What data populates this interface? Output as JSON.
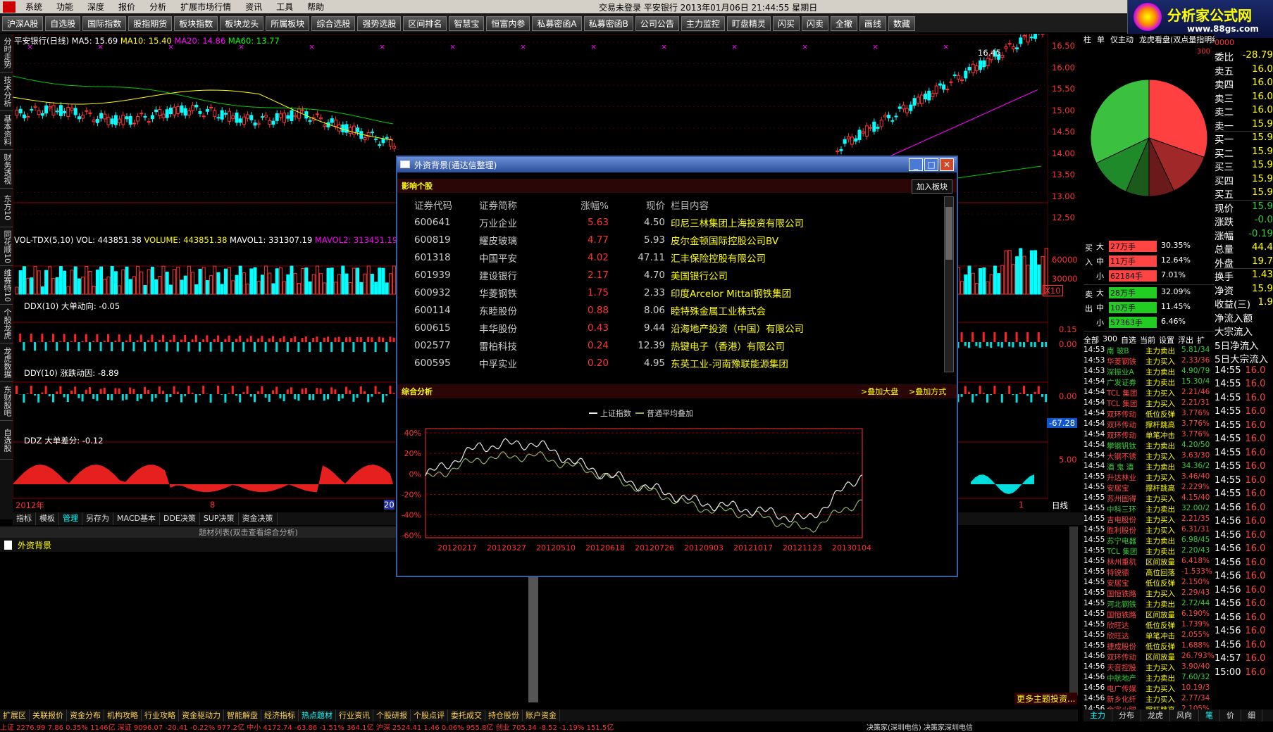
{
  "menubar": {
    "items": [
      "系统",
      "功能",
      "深度",
      "报价",
      "分析",
      "扩展市场行情",
      "资讯",
      "工具",
      "帮助"
    ],
    "center_text": "交易未登录   平安银行  2013年01月06日  21:44:55  星期日"
  },
  "logo": {
    "text": "分析家公式网",
    "url": "www.88gs.com"
  },
  "toolbar": {
    "buttons": [
      "沪深A股",
      "自选股",
      "国际指数",
      "股指期货",
      "板块指数",
      "板块龙头",
      "所属板块",
      "综合选股",
      "强势选股",
      "区间排名",
      "智慧宝",
      "恒富内参",
      "私募密函A",
      "私募密函B",
      "公司公告",
      "主力监控",
      "盯盘精灵",
      "闪买",
      "闪卖",
      "全撤",
      "画线",
      "数藏"
    ]
  },
  "left_tabs": [
    "分时走势",
    "技术分析",
    "基本资料",
    "财务透视",
    "东方10",
    "同花顺10",
    "维赛特10",
    "个股龙虎榜",
    "龙虎数据",
    "东财股吧",
    "自选股"
  ],
  "price_chart": {
    "title": "平安银行(日线)",
    "ma5": "MA5: 15.69",
    "ma10": "MA10: 15.40",
    "ma20": "MA20: 14.86",
    "ma60": "MA60: 13.77",
    "high_label": "16.45",
    "yticks": [
      "16.50",
      "16.00",
      "15.50",
      "15.00",
      "14.50",
      "14.00",
      "13.50",
      "13.00",
      "12.50"
    ]
  },
  "vol_chart": {
    "title": "VOL-TDX(5,10)",
    "vol": "VOL: 443851.38",
    "volume": "VOLUME: 443851.38",
    "mavol1": "MAVOL1: 331307.19",
    "mavol2": "MAVOL2: 313451.19",
    "yticks": [
      "60000",
      "30000"
    ],
    "unit": "X10"
  },
  "ddx": {
    "title": "DDX(10) 大单动向: -0.05",
    "yticks": [
      "0.15",
      "0.00"
    ]
  },
  "ddy": {
    "title": "DDY(10) 涨跌动因: -8.89",
    "ytick": "0.00",
    "badge": "-67.28"
  },
  "ddz": {
    "title": "DDZ 大单差分: -0.12",
    "ytick": "5.00"
  },
  "date_axis": {
    "left": "2012年",
    "mid": "8",
    "mid2": "20",
    "right": "1",
    "period": "日线"
  },
  "bottom_tabs": [
    "指标",
    "模板",
    "管理",
    "另存为",
    "MACD基本",
    "DDE决策",
    "SUP决策",
    "资金决策"
  ],
  "topic_list": {
    "header": "题材列表(双击查看综合分析)",
    "items": [
      "外资背景"
    ],
    "more": "更多主题投资..."
  },
  "dialog": {
    "title": "外资背景(通达信整理)",
    "section1": "影响个股",
    "add_button": "加入板块",
    "columns": [
      "证券代码",
      "证券简称",
      "涨幅%",
      "现价",
      "栏目内容"
    ],
    "rows": [
      [
        "600641",
        "万业企业",
        "5.63",
        "4.50",
        "印尼三林集团上海投资有限公司"
      ],
      [
        "600819",
        "耀皮玻璃",
        "4.77",
        "5.93",
        "皮尔金顿国际控股公司BV"
      ],
      [
        "601318",
        "中国平安",
        "4.02",
        "47.11",
        "汇丰保险控股有限公司"
      ],
      [
        "601939",
        "建设银行",
        "2.17",
        "4.70",
        "美国银行公司"
      ],
      [
        "600932",
        "华菱钢铁",
        "1.75",
        "2.33",
        "印度Arcelor Mittal钢铁集团"
      ],
      [
        "600114",
        "东睦股份",
        "0.88",
        "8.06",
        "睦特殊金属工业株式会"
      ],
      [
        "600615",
        "丰华股份",
        "0.43",
        "9.44",
        "沿海地产投资（中国）有限公司"
      ],
      [
        "002577",
        "雷柏科技",
        "0.24",
        "12.39",
        "热键电子（香港）有限公司"
      ],
      [
        "600595",
        "中孚实业",
        "0.20",
        "4.95",
        "东英工业-河南豫联能源集团"
      ]
    ],
    "section2": "综合分析",
    "overlay_market": ">叠加大盘",
    "overlay_mode": ">叠加方式",
    "legend": [
      "上证指数",
      "普通平均叠加"
    ],
    "colors": {
      "index": "#e8e8e8",
      "avg": "#8fae6a",
      "up": "#ff3030"
    }
  },
  "chart_data": {
    "type": "line",
    "x": [
      "20120217",
      "20120327",
      "20120510",
      "20120618",
      "20120726",
      "20120903",
      "20121017",
      "20121123",
      "20130104"
    ],
    "yticks": [
      "40%",
      "20%",
      "0%",
      "-20%",
      "-40%",
      "-60%"
    ],
    "ylim": [
      -60,
      40
    ],
    "series": [
      {
        "name": "上证指数",
        "values": [
          -2,
          27,
          30,
          5,
          -12,
          -28,
          -35,
          -45,
          0
        ]
      },
      {
        "name": "普通平均叠加",
        "values": [
          -5,
          15,
          18,
          3,
          -15,
          -33,
          -40,
          -55,
          -25
        ]
      }
    ]
  },
  "right_panel": {
    "tabs": [
      "柱",
      "单",
      "仅主动",
      "龙虎看盘(双点量指明细)"
    ],
    "pie_label": "300",
    "buy": {
      "label": "买入",
      "rows": [
        [
          "大",
          "27万手",
          "30.35%"
        ],
        [
          "中",
          "11万手",
          "12.64%"
        ],
        [
          "小",
          "62184手",
          "7.01%"
        ]
      ]
    },
    "sell": {
      "label": "卖出",
      "rows": [
        [
          "大",
          "28万手",
          "32.09%"
        ],
        [
          "中",
          "10万手",
          "11.45%"
        ],
        [
          "小",
          "57363手",
          "6.46%"
        ]
      ]
    },
    "filter_tabs": [
      "全部",
      "300",
      "自选",
      "当前",
      "设置",
      "浮出",
      "扩"
    ],
    "flow": [
      [
        "14:53",
        "南 玻B",
        "主力卖出",
        "5.81/34"
      ],
      [
        "14:53",
        "华菱钢铁",
        "主力买入",
        "2.33/36"
      ],
      [
        "14:53",
        "深振业A",
        "主力卖出",
        "4.90/79"
      ],
      [
        "14:54",
        "广发证券",
        "主力卖出",
        "15.30/4"
      ],
      [
        "14:54",
        "TCL 集团",
        "主力买入",
        "2.21/46"
      ],
      [
        "14:54",
        "TCL 集团",
        "主力买入",
        "2.21/31"
      ],
      [
        "14:54",
        "双环传动",
        "低位反弹",
        "3.776%"
      ],
      [
        "14:54",
        "双环传动",
        "撑杆跳高",
        "3.776%"
      ],
      [
        "14:54",
        "双环传动",
        "单笔冲击",
        "3.776%"
      ],
      [
        "14:54",
        "攀钢钒钛",
        "主力卖出",
        "4.20/50"
      ],
      [
        "14:54",
        "大钢不锈",
        "主力买入",
        "3.63/30"
      ],
      [
        "14:54",
        "酒 鬼 酒",
        "主力卖出",
        "34.36/2"
      ],
      [
        "14:55",
        "升达林业",
        "主力买入",
        "3.46/40"
      ],
      [
        "14:55",
        "安居宝",
        "撑杆跳高",
        "2.229%"
      ],
      [
        "14:55",
        "苏州固得",
        "主力买入",
        "4.15/40"
      ],
      [
        "14:55",
        "中科三环",
        "主力卖出",
        "32.00/2"
      ],
      [
        "14:55",
        "吉电股份",
        "主力买入",
        "2.21/35"
      ],
      [
        "14:55",
        "胜利股份",
        "主力买入",
        "6.31/31"
      ],
      [
        "14:55",
        "苏宁电器",
        "主力卖出",
        "6.98/45"
      ],
      [
        "14:55",
        "TCL 集团",
        "主力卖出",
        "2.20/43"
      ],
      [
        "14:55",
        "林州重机",
        "区间放量",
        "6.418%"
      ],
      [
        "14:55",
        "特锐德",
        "高位回落",
        "-1.533%"
      ],
      [
        "14:55",
        "安居宝",
        "低位反弹",
        "2.150%"
      ],
      [
        "14:55",
        "国恒铁路",
        "主力买入",
        "2.29/43"
      ],
      [
        "14:55",
        "河北钢铁",
        "主力卖出",
        "2.72/44"
      ],
      [
        "14:55",
        "国恒铁路",
        "区间放量",
        "6.190%"
      ],
      [
        "14:55",
        "欣旺达",
        "低位反弹",
        "1.739%"
      ],
      [
        "14:55",
        "欣旺达",
        "单笔冲击",
        "2.055%"
      ],
      [
        "14:55",
        "捷成股份",
        "低位反弹",
        "1.688%"
      ],
      [
        "14:56",
        "双环传动",
        "区间放量",
        "26.793%"
      ],
      [
        "14:56",
        "天音控股",
        "主力买入",
        "3.90/40"
      ],
      [
        "14:56",
        "中航地产",
        "主力卖出",
        "7.60/32"
      ],
      [
        "14:56",
        "电广传媒",
        "主力买入",
        "10.19/3"
      ],
      [
        "14:56",
        "新乡化纤",
        "主力买入",
        "2.77/34"
      ],
      [
        "14:56",
        "金字火腿",
        "撑杆跳高",
        "2.105%"
      ]
    ]
  },
  "quote": {
    "rows": [
      [
        "委比",
        "-28.79"
      ],
      [
        "卖五",
        "16.0"
      ],
      [
        "卖四",
        "16.0"
      ],
      [
        "卖三",
        "16.0"
      ],
      [
        "卖二",
        "16.0"
      ],
      [
        "卖一",
        "15.9"
      ],
      [
        "买一",
        "15.9"
      ],
      [
        "买二",
        "15.9"
      ],
      [
        "买三",
        "15.9"
      ],
      [
        "买四",
        "15.9"
      ],
      [
        "买五",
        "15.9"
      ],
      [
        "现价",
        "15.9"
      ],
      [
        "涨跌",
        "-0.0"
      ],
      [
        "涨幅",
        "-0.19"
      ],
      [
        "总量",
        "44.4"
      ],
      [
        "外盘",
        "19.7"
      ],
      [
        "换手",
        "1.43"
      ],
      [
        "净资",
        "15.9"
      ],
      [
        "收益(三)",
        "1.9"
      ],
      [
        "净流入额",
        ""
      ],
      [
        "大宗流入",
        ""
      ],
      [
        "5日净流入",
        ""
      ],
      [
        "5日大宗流入",
        ""
      ]
    ],
    "ticks": [
      [
        "14:55",
        "16.0"
      ],
      [
        "14:55",
        "16.0"
      ],
      [
        "14:55",
        "16.0"
      ],
      [
        "14:55",
        "16.0"
      ],
      [
        "14:55",
        "16.0"
      ],
      [
        "14:55",
        "16.0"
      ],
      [
        "14:55",
        "16.0"
      ],
      [
        "14:55",
        "16.0"
      ],
      [
        "14:55",
        "16.0"
      ],
      [
        "14:55",
        "16.0"
      ],
      [
        "14:56",
        "16.0"
      ],
      [
        "14:56",
        "16.0"
      ],
      [
        "14:56",
        "16.0"
      ],
      [
        "14:56",
        "16.0"
      ],
      [
        "14:56",
        "16.0"
      ],
      [
        "14:56",
        "16.0"
      ],
      [
        "14:56",
        "16.0"
      ],
      [
        "14:56",
        "16.0"
      ],
      [
        "14:56",
        "16.0"
      ],
      [
        "14:56",
        "16.0"
      ],
      [
        "14:56",
        "16.0"
      ],
      [
        "14:57",
        "16.0"
      ],
      [
        "15:00",
        "16.0"
      ]
    ],
    "right_top": "0000"
  },
  "right_bottom_tabs": [
    "主力",
    "分布",
    "龙虎",
    "风向",
    "笔",
    "价",
    "细"
  ],
  "func_tabs": [
    "扩展区",
    "关联报价",
    "资金分布",
    "机构攻略",
    "行业攻略",
    "资金驱动力",
    "智能解盘",
    "经济指标",
    "热点题材",
    "行业资讯",
    "个股研报",
    "个股点评",
    "委托成交",
    "持仓股份",
    "账户资金"
  ],
  "statusbar": {
    "text": "上证 2276.99  7.86  0.35%  1146亿  深证 9096.07  -20.41  -0.22%  977.2亿  中小 4172.74  -63.86  -1.51%  364.1亿  沪深 2524.41  1.46  0.06%  955.8亿  创业 705.34  -8.52  -1.19%  151.5亿",
    "right": "决策家(深圳电信)  决策家深圳电信"
  }
}
